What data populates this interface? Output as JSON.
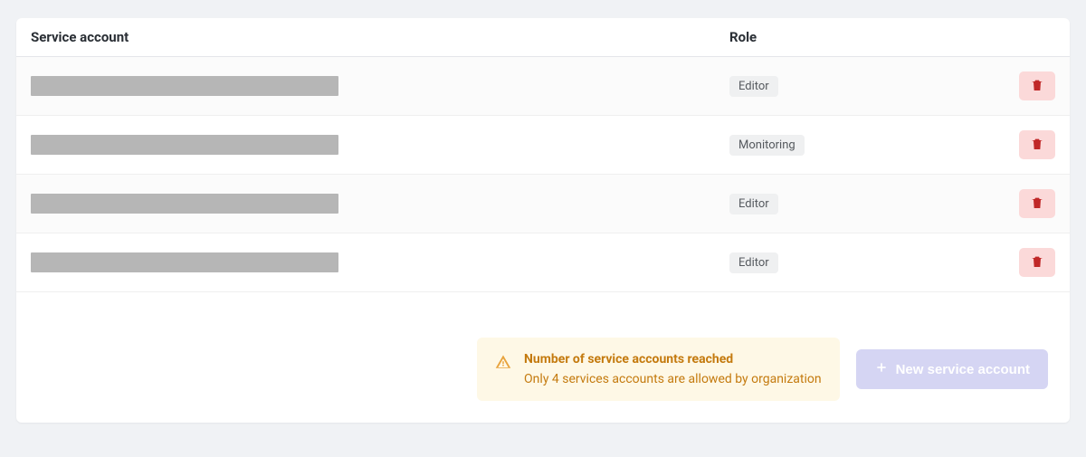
{
  "table": {
    "header": {
      "name": "Service account",
      "role": "Role"
    },
    "rows": [
      {
        "role": "Editor"
      },
      {
        "role": "Monitoring"
      },
      {
        "role": "Editor"
      },
      {
        "role": "Editor"
      }
    ]
  },
  "warning": {
    "title": "Number of service accounts reached",
    "subtitle": "Only 4 services accounts are allowed by organization"
  },
  "actions": {
    "new_label": "New service account"
  }
}
